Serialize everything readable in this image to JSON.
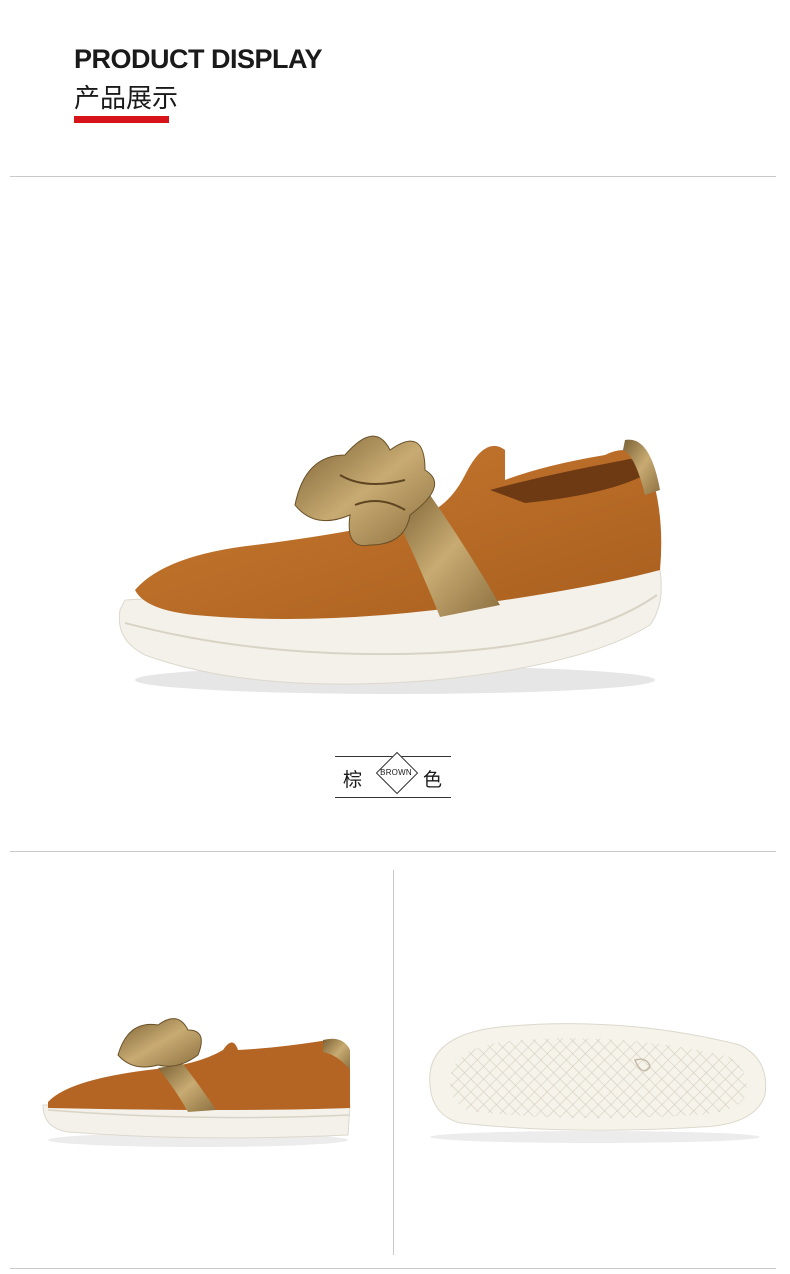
{
  "header": {
    "title": "PRODUCT DISPLAY",
    "subtitle": "产品展示",
    "accent_color": "#d8141b"
  },
  "color_tag": {
    "left_char": "棕",
    "english": "BROWN",
    "right_char": "色"
  },
  "colors": {
    "suede": "#b86a26",
    "suede_dark": "#8e4f18",
    "metallic": "#a88a56",
    "sole": "#f7f4ec",
    "divider": "#c9c9c9"
  },
  "images": [
    {
      "name": "shoe-three-quarter-view"
    },
    {
      "name": "shoe-side-view"
    },
    {
      "name": "shoe-sole-view"
    }
  ]
}
